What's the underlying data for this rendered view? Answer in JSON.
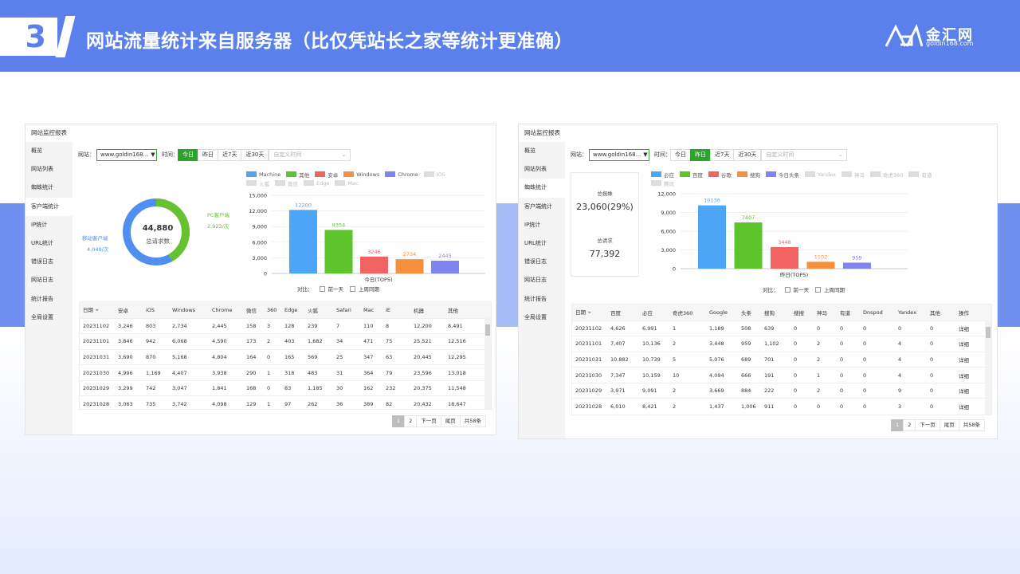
{
  "header": {
    "number": "3",
    "title": "网站流量统计来自服务器（比仅凭站长之家等统计更准确）",
    "logo_title": "金汇网",
    "logo_sub": "goldin168.com"
  },
  "p1": {
    "window_title": "网站监控报表",
    "sidebar": [
      "概览",
      "网站列表",
      "蜘蛛统计",
      "客户端统计",
      "IP统计",
      "URL统计",
      "错误日志",
      "网站日志",
      "统计报告",
      "全局设置"
    ],
    "site_label": "网站：",
    "site_value": "www.goldin168...",
    "time_label": "时间：",
    "time_buttons": [
      "今日",
      "昨日",
      "近7天",
      "近30天"
    ],
    "date_placeholder": "自定义时间",
    "donut": {
      "total": "44,880",
      "total_label": "总请求数",
      "pc_label": "PC客户端",
      "pc_value": "2,923/次",
      "mobile_label": "移动客户端",
      "mobile_value": "4,049/次",
      "pc_fraction": 0.42
    },
    "legend": [
      {
        "name": "Machine",
        "color": "#4da6f5",
        "dim": false
      },
      {
        "name": "其他",
        "color": "#5ec42c",
        "dim": false
      },
      {
        "name": "安卓",
        "color": "#f16262",
        "dim": false
      },
      {
        "name": "Windows",
        "color": "#f5913e",
        "dim": false
      },
      {
        "name": "Chrome",
        "color": "#8184ef",
        "dim": false
      },
      {
        "name": "iOS",
        "color": "#ddd",
        "dim": true
      },
      {
        "name": "火狐",
        "color": "#ddd",
        "dim": true
      },
      {
        "name": "微信",
        "color": "#ddd",
        "dim": true
      },
      {
        "name": "Edge",
        "color": "#ddd",
        "dim": true
      },
      {
        "name": "Mac",
        "color": "#ddd",
        "dim": true
      }
    ],
    "chart_data": {
      "type": "bar",
      "categories": [
        "Machine",
        "其他",
        "安卓",
        "Windows",
        "Chrome"
      ],
      "values": [
        12200,
        8354,
        3246,
        2734,
        2445
      ],
      "value_labels": [
        "12200",
        "8354",
        "3246",
        "2734",
        "2445"
      ],
      "colors": [
        "#4da6f5",
        "#5ec42c",
        "#f16262",
        "#f5913e",
        "#8184ef"
      ],
      "label_colors": [
        "#4da6f5",
        "#5ec42c",
        "#f16262",
        "#f5913e",
        "#8184ef"
      ],
      "yticks": [
        "15,000",
        "12,000",
        "9,000",
        "6,000",
        "3,000",
        "0"
      ],
      "ylim": [
        0,
        15000
      ],
      "xlabel": "今日(TOP5)"
    },
    "compare_label": "对比：",
    "compare_opts": [
      "前一天",
      "上周同期"
    ],
    "table": {
      "headers": [
        "日期",
        "安卓",
        "iOS",
        "Windows",
        "Chrome",
        "微信",
        "360",
        "Edge",
        "火狐",
        "Safari",
        "Mac",
        "IE",
        "机器",
        "其他"
      ],
      "rows": [
        [
          "20231102",
          "3,246",
          "803",
          "2,734",
          "2,445",
          "158",
          "3",
          "128",
          "239",
          "7",
          "110",
          "8",
          "12,200",
          "8,491"
        ],
        [
          "20231101",
          "3,846",
          "942",
          "6,068",
          "4,590",
          "173",
          "2",
          "403",
          "1,682",
          "34",
          "471",
          "75",
          "25,521",
          "12,516"
        ],
        [
          "20231031",
          "3,690",
          "870",
          "5,168",
          "4,804",
          "164",
          "0",
          "165",
          "569",
          "25",
          "347",
          "63",
          "20,445",
          "12,295"
        ],
        [
          "20231030",
          "4,996",
          "1,169",
          "4,407",
          "3,938",
          "290",
          "1",
          "318",
          "483",
          "31",
          "364",
          "79",
          "23,596",
          "13,018"
        ],
        [
          "20231029",
          "3,299",
          "742",
          "3,047",
          "1,841",
          "168",
          "0",
          "83",
          "1,185",
          "30",
          "162",
          "232",
          "20,375",
          "11,548"
        ],
        [
          "20231028",
          "3,063",
          "735",
          "3,742",
          "4,098",
          "129",
          "1",
          "97",
          "262",
          "36",
          "389",
          "82",
          "20,432",
          "18,647"
        ]
      ]
    },
    "pager": [
      "1",
      "2",
      "下一页",
      "尾页",
      "共58条"
    ]
  },
  "p2": {
    "window_title": "网站监控报表",
    "sidebar": [
      "概览",
      "网站列表",
      "蜘蛛统计",
      "客户端统计",
      "IP统计",
      "URL统计",
      "错误日志",
      "网站日志",
      "统计报告",
      "全局设置"
    ],
    "site_label": "网站：",
    "site_value": "www.goldin168...",
    "time_label": "时间：",
    "time_buttons": [
      "今日",
      "昨日",
      "近7天",
      "近30天"
    ],
    "date_placeholder": "自定义时间",
    "stats": {
      "spider_label": "总蜘蛛",
      "spider_value": "23,060(29%)",
      "req_label": "总请求",
      "req_value": "77,392"
    },
    "legend": [
      {
        "name": "必应",
        "color": "#4da6f5",
        "dim": false
      },
      {
        "name": "百度",
        "color": "#5ec42c",
        "dim": false
      },
      {
        "name": "谷歌",
        "color": "#f16262",
        "dim": false
      },
      {
        "name": "搜狗",
        "color": "#f5913e",
        "dim": false
      },
      {
        "name": "今日头条",
        "color": "#8184ef",
        "dim": false
      },
      {
        "name": "Yandex",
        "color": "#ddd",
        "dim": true
      },
      {
        "name": "神马",
        "color": "#ddd",
        "dim": true
      },
      {
        "name": "奇虎360",
        "color": "#ddd",
        "dim": true
      },
      {
        "name": "有道",
        "color": "#ddd",
        "dim": true
      },
      {
        "name": "腾讯",
        "color": "#ddd",
        "dim": true
      }
    ],
    "chart_data": {
      "type": "bar",
      "categories": [
        "必应",
        "百度",
        "谷歌",
        "搜狗",
        "今日头条"
      ],
      "values": [
        10136,
        7407,
        3448,
        1102,
        959
      ],
      "value_labels": [
        "10136",
        "7407",
        "3448",
        "1102",
        "959"
      ],
      "colors": [
        "#4da6f5",
        "#5ec42c",
        "#f16262",
        "#f5913e",
        "#8184ef"
      ],
      "label_colors": [
        "#4da6f5",
        "#5ec42c",
        "#f16262",
        "#f5913e",
        "#8184ef"
      ],
      "yticks": [
        "12,000",
        "9,000",
        "6,000",
        "3,000",
        "0"
      ],
      "ylim": [
        0,
        12000
      ],
      "xlabel": "昨日(TOP5)"
    },
    "compare_label": "对比：",
    "compare_opts": [
      "前一天",
      "上周同期"
    ],
    "table": {
      "headers": [
        "日期",
        "百度",
        "必应",
        "奇虎360",
        "Google",
        "头条",
        "搜狗",
        "搜搜",
        "神马",
        "有道",
        "Dnspod",
        "Yandex",
        "其他",
        "操作"
      ],
      "detail": "详细",
      "rows": [
        [
          "20231102",
          "4,626",
          "6,991",
          "1",
          "1,189",
          "508",
          "639",
          "0",
          "0",
          "0",
          "0",
          "0",
          "0"
        ],
        [
          "20231101",
          "7,407",
          "10,136",
          "2",
          "3,448",
          "959",
          "1,102",
          "0",
          "2",
          "0",
          "0",
          "4",
          "0"
        ],
        [
          "20231031",
          "10,882",
          "10,739",
          "5",
          "5,076",
          "689",
          "701",
          "0",
          "2",
          "0",
          "0",
          "4",
          "0"
        ],
        [
          "20231030",
          "7,347",
          "10,159",
          "10",
          "4,094",
          "666",
          "191",
          "0",
          "1",
          "0",
          "0",
          "4",
          "0"
        ],
        [
          "20231029",
          "3,971",
          "9,091",
          "2",
          "3,669",
          "884",
          "222",
          "0",
          "2",
          "0",
          "0",
          "9",
          "0"
        ],
        [
          "20231028",
          "6,010",
          "8,421",
          "2",
          "1,437",
          "1,006",
          "911",
          "0",
          "0",
          "0",
          "0",
          "3",
          "0"
        ]
      ]
    },
    "pager": [
      "1",
      "2",
      "下一页",
      "尾页",
      "共58条"
    ]
  }
}
